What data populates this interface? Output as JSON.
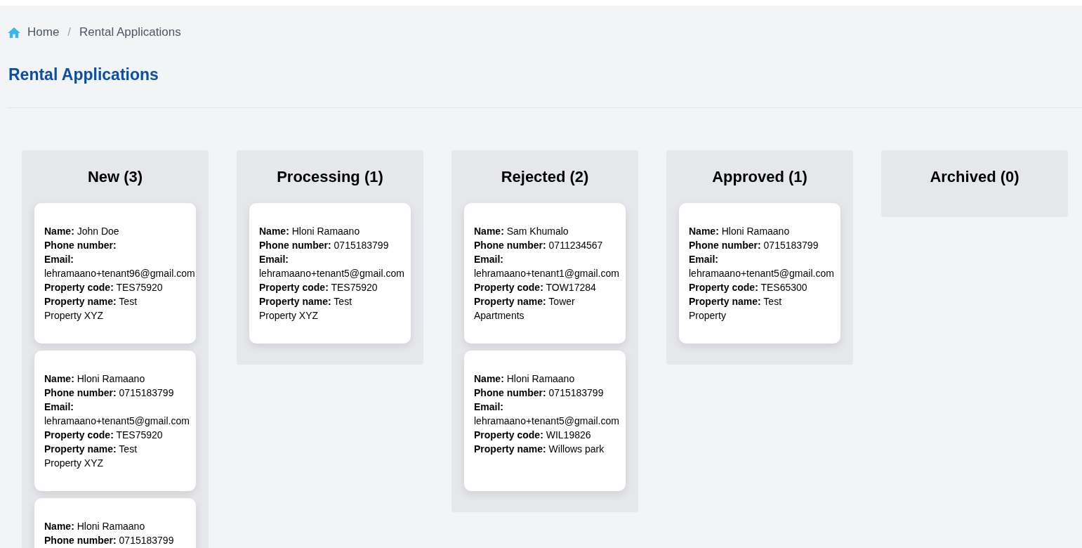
{
  "breadcrumb": {
    "separator": "/",
    "items": [
      {
        "label": "Home",
        "kind": "home_link"
      },
      {
        "label": "Rental Applications",
        "kind": "current"
      }
    ]
  },
  "page_title": "Rental Applications",
  "columns": [
    {
      "title": "New (3)",
      "cards": [
        {
          "fields": [
            {
              "label": "Name:",
              "value": "John Doe"
            },
            {
              "label": "Phone number:"
            },
            {
              "label": "Email:",
              "value": "lehramaano+tenant96@gmail.com"
            },
            {
              "label": "Property code:",
              "value": "TES75920"
            },
            {
              "label": "Property name:",
              "value": "Test Property XYZ"
            }
          ]
        },
        {
          "fields": [
            {
              "label": "Name:",
              "value": "Hloni Ramaano"
            },
            {
              "label": "Phone number:",
              "value": "0715183799"
            },
            {
              "label": "Email:",
              "value": "lehramaano+tenant5@gmail.com"
            },
            {
              "label": "Property code:",
              "value": "TES75920"
            },
            {
              "label": "Property name:",
              "value": "Test Property XYZ"
            }
          ]
        },
        {
          "fields": [
            {
              "label": "Name:",
              "value": "Hloni Ramaano"
            },
            {
              "label": "Phone number:",
              "value": "0715183799"
            }
          ]
        }
      ]
    },
    {
      "title": "Processing (1)",
      "cards": [
        {
          "fields": [
            {
              "label": "Name:",
              "value": "Hloni Ramaano"
            },
            {
              "label": "Phone number:",
              "value": "0715183799"
            },
            {
              "label": "Email:",
              "value": "lehramaano+tenant5@gmail.com"
            },
            {
              "label": "Property code:",
              "value": "TES75920"
            },
            {
              "label": "Property name:",
              "value": "Test Property XYZ"
            }
          ]
        }
      ]
    },
    {
      "title": "Rejected (2)",
      "cards": [
        {
          "fields": [
            {
              "label": "Name:",
              "value": "Sam Khumalo"
            },
            {
              "label": "Phone number:",
              "value": "0711234567"
            },
            {
              "label": "Email:",
              "value": "lehramaano+tenant1@gmail.com"
            },
            {
              "label": "Property code:",
              "value": "TOW17284"
            },
            {
              "label": "Property name:",
              "value": "Tower Apartments"
            }
          ]
        },
        {
          "fields": [
            {
              "label": "Name:",
              "value": "Hloni Ramaano"
            },
            {
              "label": "Phone number:",
              "value": "0715183799"
            },
            {
              "label": "Email:",
              "value": "lehramaano+tenant5@gmail.com"
            },
            {
              "label": "Property code:",
              "value": "WIL19826"
            },
            {
              "label": "Property name:",
              "value": "Willows park"
            }
          ]
        }
      ]
    },
    {
      "title": "Approved (1)",
      "cards": [
        {
          "fields": [
            {
              "label": "Name:",
              "value": "Hloni Ramaano"
            },
            {
              "label": "Phone number:",
              "value": "0715183799"
            },
            {
              "label": "Email:",
              "value": "lehramaano+tenant5@gmail.com"
            },
            {
              "label": "Property code:",
              "value": "TES65300"
            },
            {
              "label": "Property name:",
              "value": "Test Property"
            }
          ]
        }
      ]
    },
    {
      "title": "Archived (0)"
    }
  ]
}
